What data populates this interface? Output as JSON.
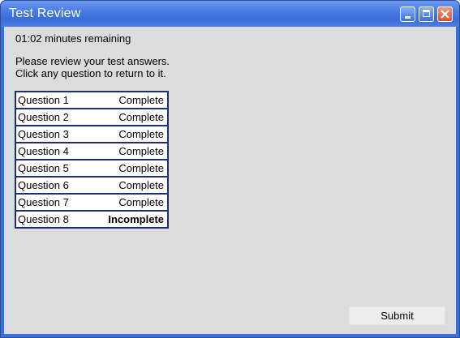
{
  "window": {
    "title": "Test Review",
    "controls": [
      "minimize",
      "maximize",
      "close"
    ]
  },
  "timer": {
    "text": "01:02 minutes remaining"
  },
  "instructions": {
    "line1": "Please review your test answers.",
    "line2": "Click any question to return to it."
  },
  "questions": [
    {
      "label": "Question 1",
      "status": "Complete"
    },
    {
      "label": "Question 2",
      "status": "Complete"
    },
    {
      "label": "Question 3",
      "status": "Complete"
    },
    {
      "label": "Question 4",
      "status": "Complete"
    },
    {
      "label": "Question 5",
      "status": "Complete"
    },
    {
      "label": "Question 6",
      "status": "Complete"
    },
    {
      "label": "Question 7",
      "status": "Complete"
    },
    {
      "label": "Question 8",
      "status": "Incomplete"
    }
  ],
  "submit": {
    "label": "Submit"
  },
  "colors": {
    "titlebar": "#4c7fe6",
    "client_background": "#dcdcdc",
    "table_border": "#1c2f6e",
    "close_button": "#d6532c"
  }
}
